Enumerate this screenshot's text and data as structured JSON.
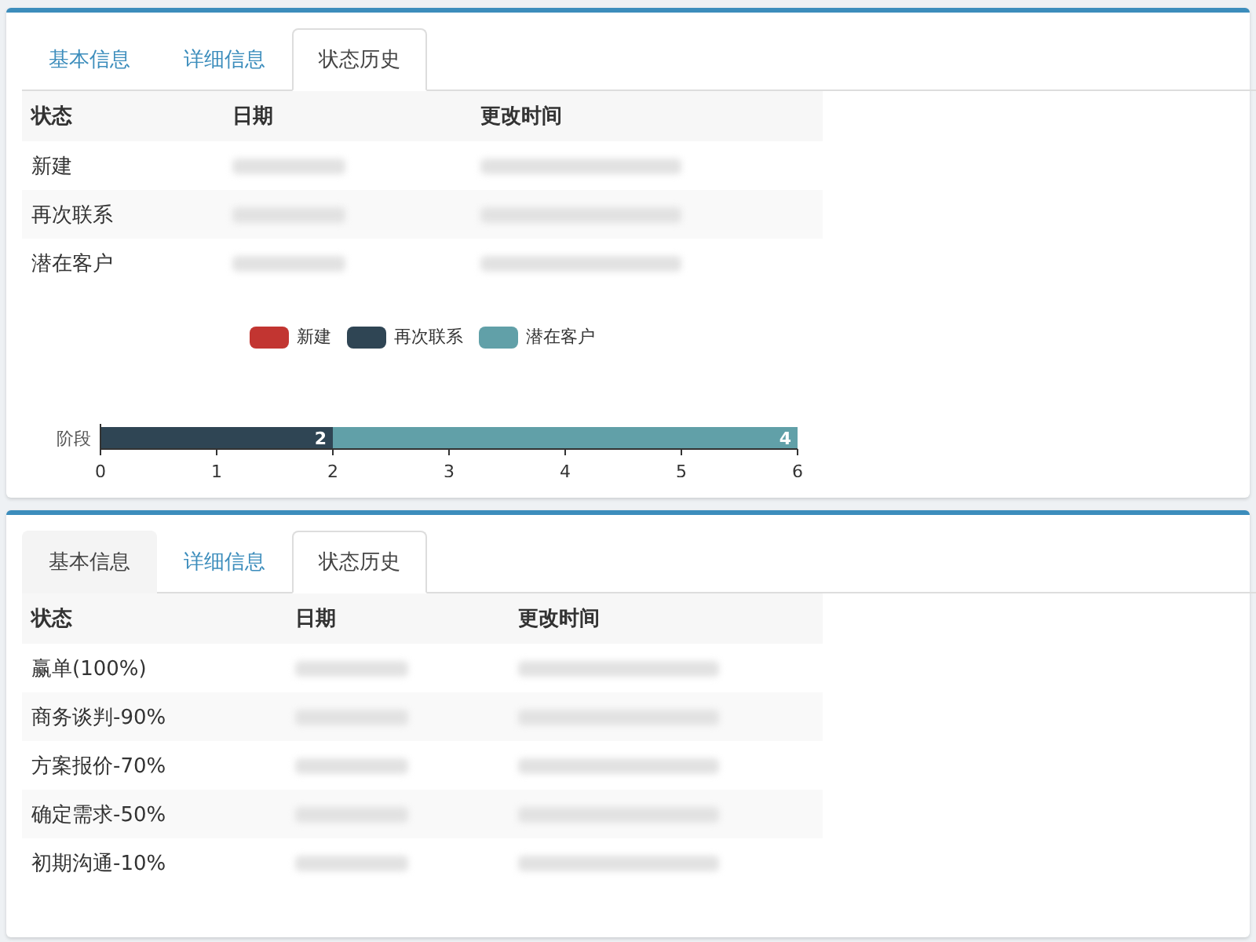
{
  "panels": [
    {
      "tabs": [
        {
          "label": "基本信息",
          "selected": false,
          "shaded": false
        },
        {
          "label": "详细信息",
          "selected": false,
          "shaded": false
        },
        {
          "label": "状态历史",
          "selected": true,
          "shaded": false
        }
      ],
      "table": {
        "columns": [
          "状态",
          "日期",
          "更改时间"
        ],
        "rows": [
          {
            "status": "新建"
          },
          {
            "status": "再次联系"
          },
          {
            "status": "潜在客户"
          }
        ]
      },
      "chart_data": {
        "type": "bar",
        "orientation": "horizontal",
        "stacked": true,
        "categories": [
          "阶段"
        ],
        "series": [
          {
            "name": "新建",
            "color": "#c23531",
            "values": [
              null
            ]
          },
          {
            "name": "再次联系",
            "color": "#2f4554",
            "values": [
              2
            ]
          },
          {
            "name": "潜在客户",
            "color": "#61a0a8",
            "values": [
              4
            ]
          }
        ],
        "xlim": [
          0,
          6
        ],
        "xticks": [
          0,
          1,
          2,
          3,
          4,
          5,
          6
        ],
        "data_labels": true
      }
    },
    {
      "tabs": [
        {
          "label": "基本信息",
          "selected": false,
          "shaded": true
        },
        {
          "label": "详细信息",
          "selected": false,
          "shaded": false
        },
        {
          "label": "状态历史",
          "selected": true,
          "shaded": false
        }
      ],
      "table": {
        "columns": [
          "状态",
          "日期",
          "更改时间"
        ],
        "rows": [
          {
            "status": "赢单(100%)"
          },
          {
            "status": "商务谈判-90%"
          },
          {
            "status": "方案报价-70%"
          },
          {
            "status": "确定需求-50%"
          },
          {
            "status": "初期沟通-10%"
          }
        ]
      }
    }
  ]
}
